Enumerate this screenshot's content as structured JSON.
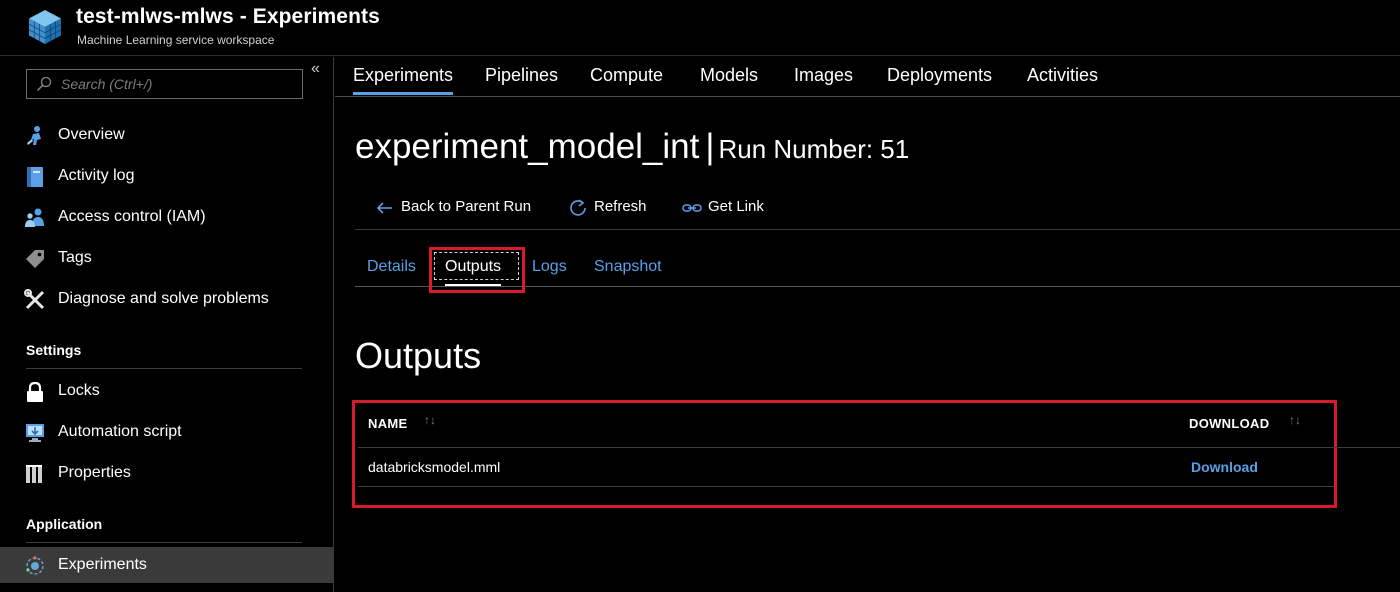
{
  "header": {
    "title": "test-mlws-mlws - Experiments",
    "subtitle": "Machine Learning service workspace"
  },
  "sidebar": {
    "search_placeholder": "Search (Ctrl+/)",
    "collapse_glyph": "«",
    "items": [
      {
        "label": "Overview",
        "icon": "overview-icon"
      },
      {
        "label": "Activity log",
        "icon": "activity-log-icon"
      },
      {
        "label": "Access control (IAM)",
        "icon": "access-control-icon"
      },
      {
        "label": "Tags",
        "icon": "tag-icon"
      },
      {
        "label": "Diagnose and solve problems",
        "icon": "wrench-icon"
      }
    ],
    "settings_title": "Settings",
    "settings_items": [
      {
        "label": "Locks",
        "icon": "lock-icon"
      },
      {
        "label": "Automation script",
        "icon": "automation-icon"
      },
      {
        "label": "Properties",
        "icon": "properties-icon"
      }
    ],
    "application_title": "Application",
    "application_items": [
      {
        "label": "Experiments",
        "icon": "experiments-icon",
        "active": true
      }
    ]
  },
  "topnav": {
    "tabs": [
      "Experiments",
      "Pipelines",
      "Compute",
      "Models",
      "Images",
      "Deployments",
      "Activities"
    ],
    "active": "Experiments"
  },
  "run": {
    "experiment_name": "experiment_model_int",
    "separator": "|",
    "run_number_label": "Run Number: 51"
  },
  "toolbar": {
    "back_label": "Back to Parent Run",
    "refresh_label": "Refresh",
    "get_link_label": "Get Link"
  },
  "subtabs": {
    "items": [
      "Details",
      "Outputs",
      "Logs",
      "Snapshot"
    ],
    "active": "Outputs"
  },
  "outputs": {
    "heading": "Outputs",
    "columns": {
      "name": "NAME",
      "download": "DOWNLOAD"
    },
    "sort_glyph": "↑↓",
    "rows": [
      {
        "name": "databricksmodel.mml",
        "download": "Download"
      }
    ]
  },
  "colors": {
    "accent": "#5aa0e8",
    "highlight": "#d81b2c",
    "active_nav": "#3a3a3a"
  }
}
